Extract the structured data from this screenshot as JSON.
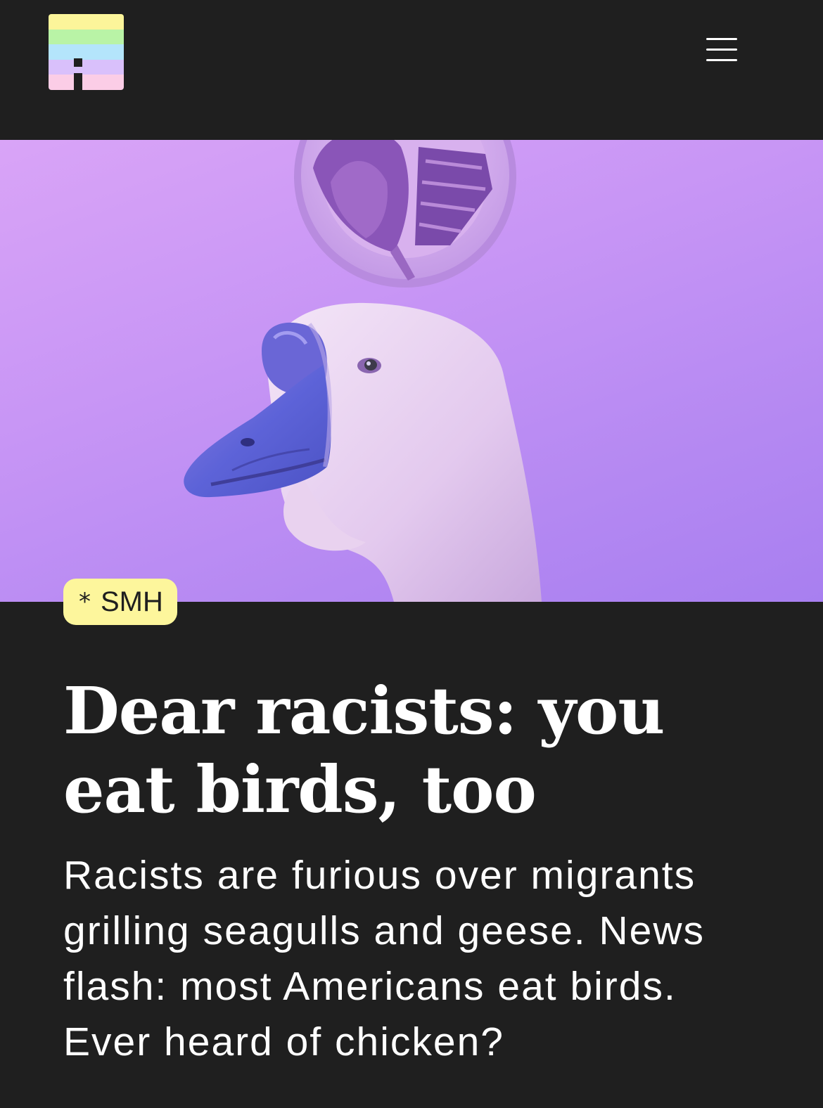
{
  "header": {
    "logo_icon": "colorful-striped-logo-icon",
    "logo_colors": [
      "#fcf59a",
      "#b9f3a6",
      "#b4e5fb",
      "#d9c0fb",
      "#fbcde6"
    ],
    "menu_icon": "hamburger-menu-icon"
  },
  "hero": {
    "image": "purple-toned-goose-with-roast-bird-plate-illustration",
    "background_color": "#c795f5"
  },
  "article": {
    "tag": {
      "icon": "asterisk-icon",
      "symbol": "*",
      "label": "SMH",
      "background_color": "#fdf69c"
    },
    "title": "Dear racists: you eat birds, too",
    "dek": "Racists are furious over migrants grilling seagulls and geese. News flash: most Americans eat birds. Ever heard of chicken?"
  },
  "theme": {
    "background": "#1f1f1f",
    "text": "#ffffff"
  }
}
